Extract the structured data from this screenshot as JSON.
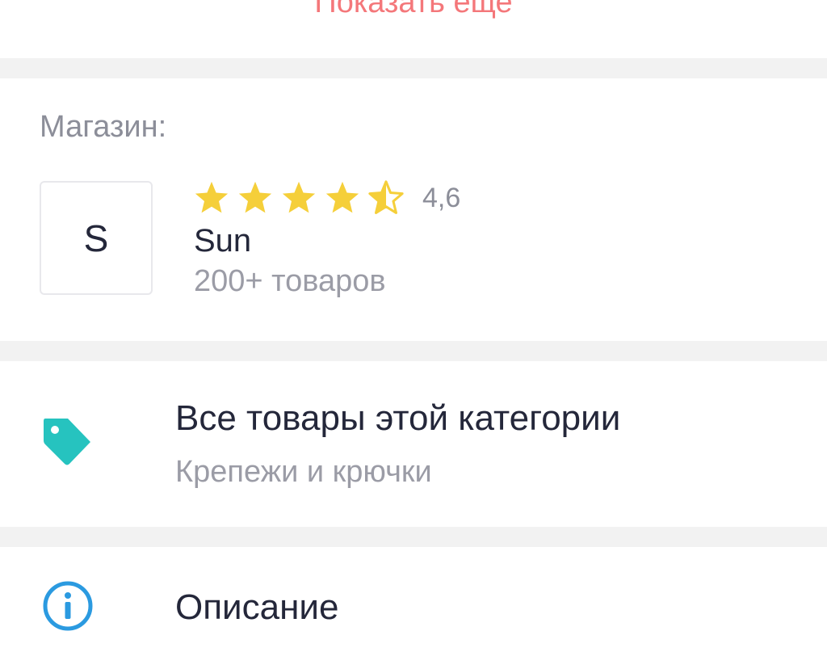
{
  "show_more": {
    "label": "Показать еще",
    "color": "#f4777a"
  },
  "shop": {
    "section_label": "Магазин:",
    "logo_letter": "S",
    "name": "Sun",
    "product_count": "200+ товаров",
    "rating": {
      "value_text": "4,6",
      "value": 4.6,
      "max": 5,
      "star_color": "#f5cf3a"
    }
  },
  "category_link": {
    "icon": "tag-icon",
    "icon_color": "#26c3bf",
    "title": "Все товары этой категории",
    "subtitle": "Крепежи и крючки"
  },
  "description_link": {
    "icon": "info-icon",
    "icon_color": "#2b9ae0",
    "title": "Описание"
  }
}
